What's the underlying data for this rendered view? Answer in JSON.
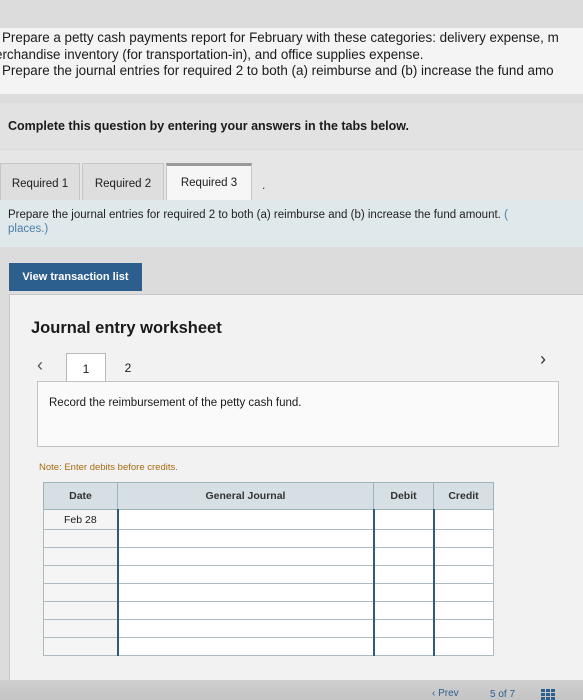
{
  "intro": {
    "lines": [
      "Prepare a petty cash payments report for February with these categories: delivery expense, m",
      "erchandise inventory (for transportation-in), and office supplies expense.",
      "Prepare the journal entries for required 2 to both (a) reimburse and (b) increase the fund amo"
    ]
  },
  "instruction": "Complete this question by entering your answers in the tabs below.",
  "tabs": [
    {
      "label": "Required 1",
      "active": false
    },
    {
      "label": "Required 2",
      "active": false
    },
    {
      "label": "Required 3",
      "active": true
    }
  ],
  "tab_ellipsis": ".",
  "required_instruction": {
    "line1": "Prepare the journal entries for required 2 to both (a) reimburse and (b) increase the fund amount.",
    "line1_cut": "(",
    "line2": "places.)"
  },
  "view_transaction_button": "View transaction list",
  "worksheet": {
    "title": "Journal entry worksheet",
    "prev_icon": "‹",
    "next_icon": "›",
    "pages": [
      "1",
      "2"
    ],
    "active_page": "1",
    "entry_description": "Record the reimbursement of the petty cash fund.",
    "note": "Note: Enter debits before credits.",
    "table": {
      "headers": {
        "date": "Date",
        "general_journal": "General Journal",
        "debit": "Debit",
        "credit": "Credit"
      },
      "rows": [
        {
          "date": "Feb 28",
          "account": "",
          "debit": "",
          "credit": ""
        },
        {
          "date": "",
          "account": "",
          "debit": "",
          "credit": ""
        },
        {
          "date": "",
          "account": "",
          "debit": "",
          "credit": ""
        },
        {
          "date": "",
          "account": "",
          "debit": "",
          "credit": ""
        },
        {
          "date": "",
          "account": "",
          "debit": "",
          "credit": ""
        },
        {
          "date": "",
          "account": "",
          "debit": "",
          "credit": ""
        },
        {
          "date": "",
          "account": "",
          "debit": "",
          "credit": ""
        },
        {
          "date": "",
          "account": "",
          "debit": "",
          "credit": ""
        }
      ]
    }
  },
  "footer": {
    "prev_label": "‹ Prev",
    "page_indicator": "5 of 7",
    "grid_icon": "grid-icon"
  },
  "colors": {
    "primary_button": "#2d5f8e",
    "note_text": "#a86a10",
    "table_header": "#d6dfe3"
  }
}
